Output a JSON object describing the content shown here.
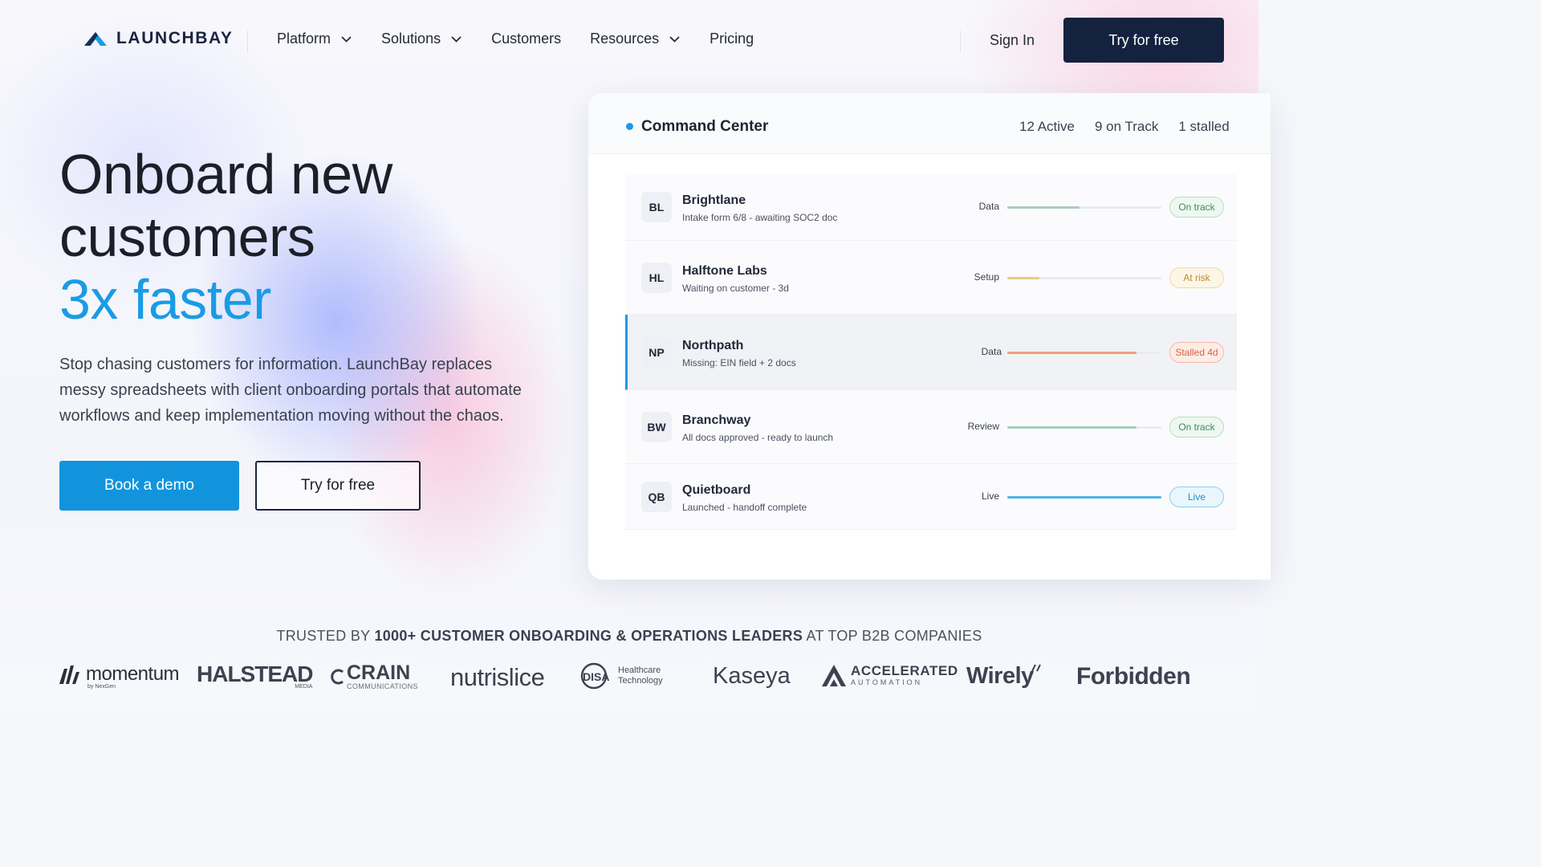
{
  "nav": {
    "brand": "LAUNCHBAY",
    "links": [
      {
        "label": "Platform",
        "has_dropdown": true
      },
      {
        "label": "Solutions",
        "has_dropdown": true
      },
      {
        "label": "Customers",
        "has_dropdown": false
      },
      {
        "label": "Resources",
        "has_dropdown": true
      },
      {
        "label": "Pricing",
        "has_dropdown": false
      }
    ],
    "sign_in": "Sign In",
    "cta": "Try for free"
  },
  "hero": {
    "title_line1": "Onboard new",
    "title_line2": "customers",
    "title_accent": "3x faster",
    "description": "Stop chasing customers for information. LaunchBay replaces messy spreadsheets with client onboarding portals that automate workflows and keep implementation moving without the chaos.",
    "primary_button": "Book a demo",
    "secondary_button": "Try for free"
  },
  "command_center": {
    "title": "Command Center",
    "stats": [
      "12 Active",
      "9 on Track",
      "1 stalled"
    ],
    "rows": [
      {
        "initials": "BL",
        "name": "Brightlane",
        "subtitle": "Intake form 6/8 - awaiting SOC2 doc",
        "stage": "Data",
        "progress": 0.47,
        "status": "On track",
        "status_kind": "ok"
      },
      {
        "initials": "HL",
        "name": "Halftone Labs",
        "subtitle": "Waiting on customer - 3d",
        "stage": "Setup",
        "progress": 0.21,
        "status": "At risk",
        "status_kind": "risk"
      },
      {
        "initials": "NP",
        "name": "Northpath",
        "subtitle": "Missing: EIN field + 2 docs",
        "stage": "Data",
        "progress": 0.84,
        "status": "Stalled 4d",
        "status_kind": "stalled",
        "selected": true
      },
      {
        "initials": "BW",
        "name": "Branchway",
        "subtitle": "All docs approved - ready to launch",
        "stage": "Review",
        "progress": 0.84,
        "status": "On track",
        "status_kind": "ok"
      },
      {
        "initials": "QB",
        "name": "Quietboard",
        "subtitle": "Launched - handoff complete",
        "stage": "Live",
        "progress": 1.0,
        "status": "Live",
        "status_kind": "live"
      }
    ]
  },
  "status_colors": {
    "ok": {
      "fill": "#a9cdb8",
      "bg": "#eef8f1",
      "border": "#b7dec4",
      "text": "#3f8a5c"
    },
    "risk": {
      "fill": "#e8c98a",
      "bg": "#fdf6e6",
      "border": "#f0dba8",
      "text": "#b88a2e"
    },
    "stalled": {
      "fill": "#ee9f7f",
      "bg": "#fdece6",
      "border": "#f4b9a2",
      "text": "#d4643c"
    },
    "live": {
      "fill": "#4fb2e6",
      "bg": "#eaf6fd",
      "border": "#8fcdf0",
      "text": "#1a8fcf"
    }
  },
  "trusted": {
    "prefix": "TRUSTED BY",
    "highlight": "1000+ CUSTOMER ONBOARDING & OPERATIONS LEADERS",
    "suffix": "AT TOP B2B COMPANIES"
  },
  "logos": {
    "momentum": {
      "name": "momentum",
      "sub": "by NexGen"
    },
    "halstead": {
      "name": "HALSTEAD",
      "sub": "MEDIA"
    },
    "crain": {
      "name": "CRAIN",
      "sub": "COMMUNICATIONS"
    },
    "nutrislice": {
      "name": "nutrislice"
    },
    "disa": {
      "name": "DISA",
      "sub1": "Healthcare",
      "sub2": "Technology"
    },
    "kaseya": {
      "name": "Kaseya"
    },
    "accelerated": {
      "name": "ACCELERATED",
      "sub": "AUTOMATION"
    },
    "wirely": {
      "name": "Wirely"
    },
    "forbidden": {
      "name": "Forbidden"
    }
  },
  "colors": {
    "accent": "#1a9be6",
    "primary_button": "#1294dd",
    "navy": "#15223f"
  }
}
